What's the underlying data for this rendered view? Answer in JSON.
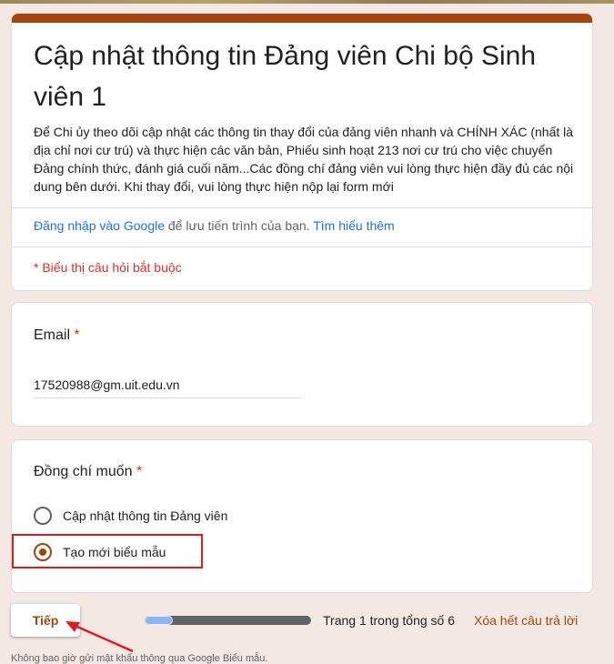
{
  "form": {
    "title": "Cập nhật thông tin Đảng viên Chi bộ Sinh viên 1",
    "description": "Để Chi ủy theo dõi cập nhật các thông tin thay đổi của đảng viên nhanh và CHÍNH XÁC (nhất là địa chỉ nơi cư trú) và thực hiện các văn bản, Phiếu sinh hoạt 213 nơi cư trú cho việc chuyển Đảng chính thức, đánh giá cuối năm...Các đồng chí đảng viên vui lòng thực hiện đầy đủ các nội dung bên dưới. Khi thay đổi, vui lòng thực hiện nộp lại form mới",
    "accent_color": "#a6440c",
    "signin": {
      "link_text": "Đăng nhập vào Google",
      "middle_text": " để lưu tiến trình của bạn. ",
      "learn_more": "Tìm hiểu thêm"
    },
    "required_note": "* Biểu thị câu hỏi bắt buộc"
  },
  "questions": {
    "email": {
      "label": "Email",
      "required_mark": "*",
      "value": "17520988@gm.uit.edu.vn"
    },
    "choice": {
      "label": "Đồng chí muốn",
      "required_mark": "*",
      "options": [
        {
          "label": "Cập nhật thông tin Đảng viên",
          "checked": false
        },
        {
          "label": "Tạo mới biểu mẫu",
          "checked": true
        }
      ]
    }
  },
  "navigation": {
    "next_label": "Tiếp",
    "progress_fraction": 0.1667,
    "page_text": "Trang 1 trong tổng số 6",
    "clear_label": "Xóa hết câu trả lời"
  },
  "footer": {
    "note": "Không bao giờ gửi mật khẩu thông qua Google Biểu mẫu."
  }
}
